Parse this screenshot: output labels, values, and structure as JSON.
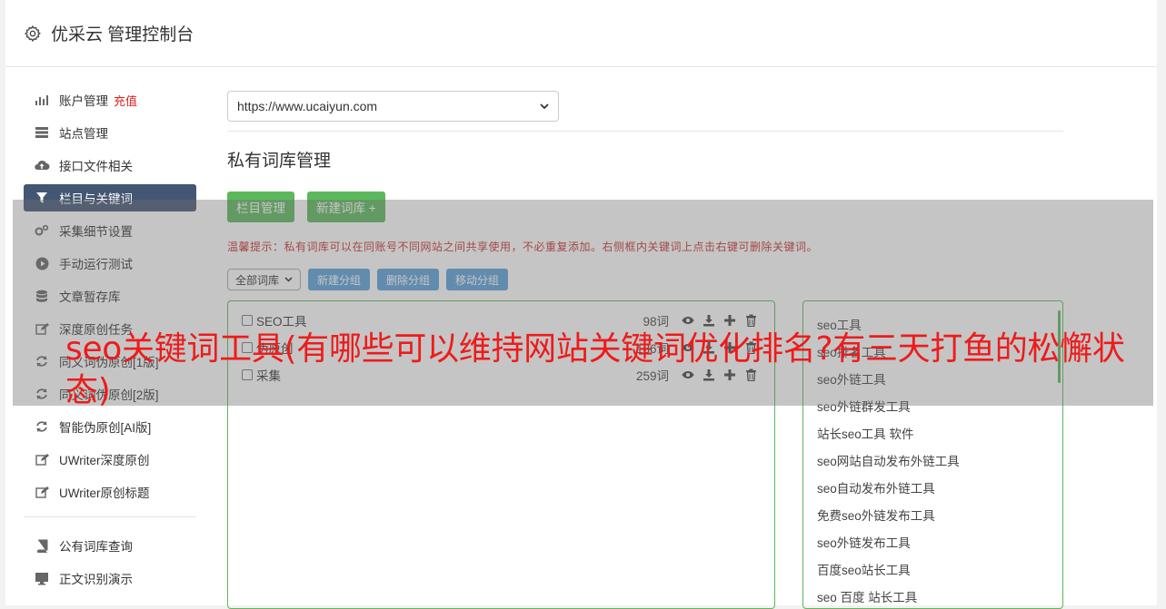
{
  "header": {
    "title": "优采云 管理控制台"
  },
  "sidebar": {
    "items": [
      {
        "label": "账户管理",
        "badge": "充值",
        "icon": "bar-chart-icon"
      },
      {
        "label": "站点管理",
        "icon": "server-icon"
      },
      {
        "label": "接口文件相关",
        "icon": "cloud-upload-icon"
      },
      {
        "label": "栏目与关键词",
        "icon": "filter-icon",
        "active": true
      },
      {
        "label": "采集细节设置",
        "icon": "gears-icon"
      },
      {
        "label": "手动运行测试",
        "icon": "play-circle-icon"
      },
      {
        "label": "文章暂存库",
        "icon": "database-icon"
      },
      {
        "label": "深度原创任务",
        "icon": "edit-icon"
      },
      {
        "label": "同义词伪原创[1版]",
        "icon": "refresh-icon"
      },
      {
        "label": "同义词伪原创[2版]",
        "icon": "refresh-icon"
      },
      {
        "label": "智能伪原创[AI版]",
        "icon": "refresh-icon"
      },
      {
        "label": "UWriter深度原创",
        "icon": "edit-icon"
      },
      {
        "label": "UWriter原创标题",
        "icon": "edit-icon"
      }
    ],
    "items2": [
      {
        "label": "公有词库查询",
        "icon": "book-icon"
      },
      {
        "label": "正文识别演示",
        "icon": "monitor-icon"
      }
    ]
  },
  "main": {
    "site_select": "https://www.ucaiyun.com",
    "section_title": "私有词库管理",
    "buttons": {
      "column_manage": "栏目管理",
      "new_lexicon": "新建词库 +"
    },
    "tip": "温馨提示：私有词库可以在同账号不同网站之间共享使用，不必重复添加。右侧框内关键词上点击右键可删除关键词。",
    "group_select": "全部词库",
    "group_buttons": {
      "new": "新建分组",
      "delete": "删除分组",
      "move": "移动分组"
    },
    "lexicons": [
      {
        "name": "SEO工具",
        "count": "98词"
      },
      {
        "name": "伪原创",
        "count": "186词"
      },
      {
        "name": "采集",
        "count": "259词"
      }
    ],
    "keywords": [
      "seo工具",
      "seo排名工具",
      "seo外链工具",
      "seo外链群发工具",
      "站长seo工具 软件",
      "seo网站自动发布外链工具",
      "seo自动发布外链工具",
      "免费seo外链发布工具",
      "seo外链发布工具",
      "百度seo站长工具",
      "seo 百度 站长工具"
    ]
  },
  "overlay": {
    "headline": "seo关键词工具(有哪些可以维持网站关键词优化排名?有三天打鱼的松懈状态)"
  },
  "colors": {
    "active_nav": "#435673",
    "green": "#5cb85c",
    "blue_btn": "#5aa0d9",
    "headline_red": "#ee1b1b"
  }
}
